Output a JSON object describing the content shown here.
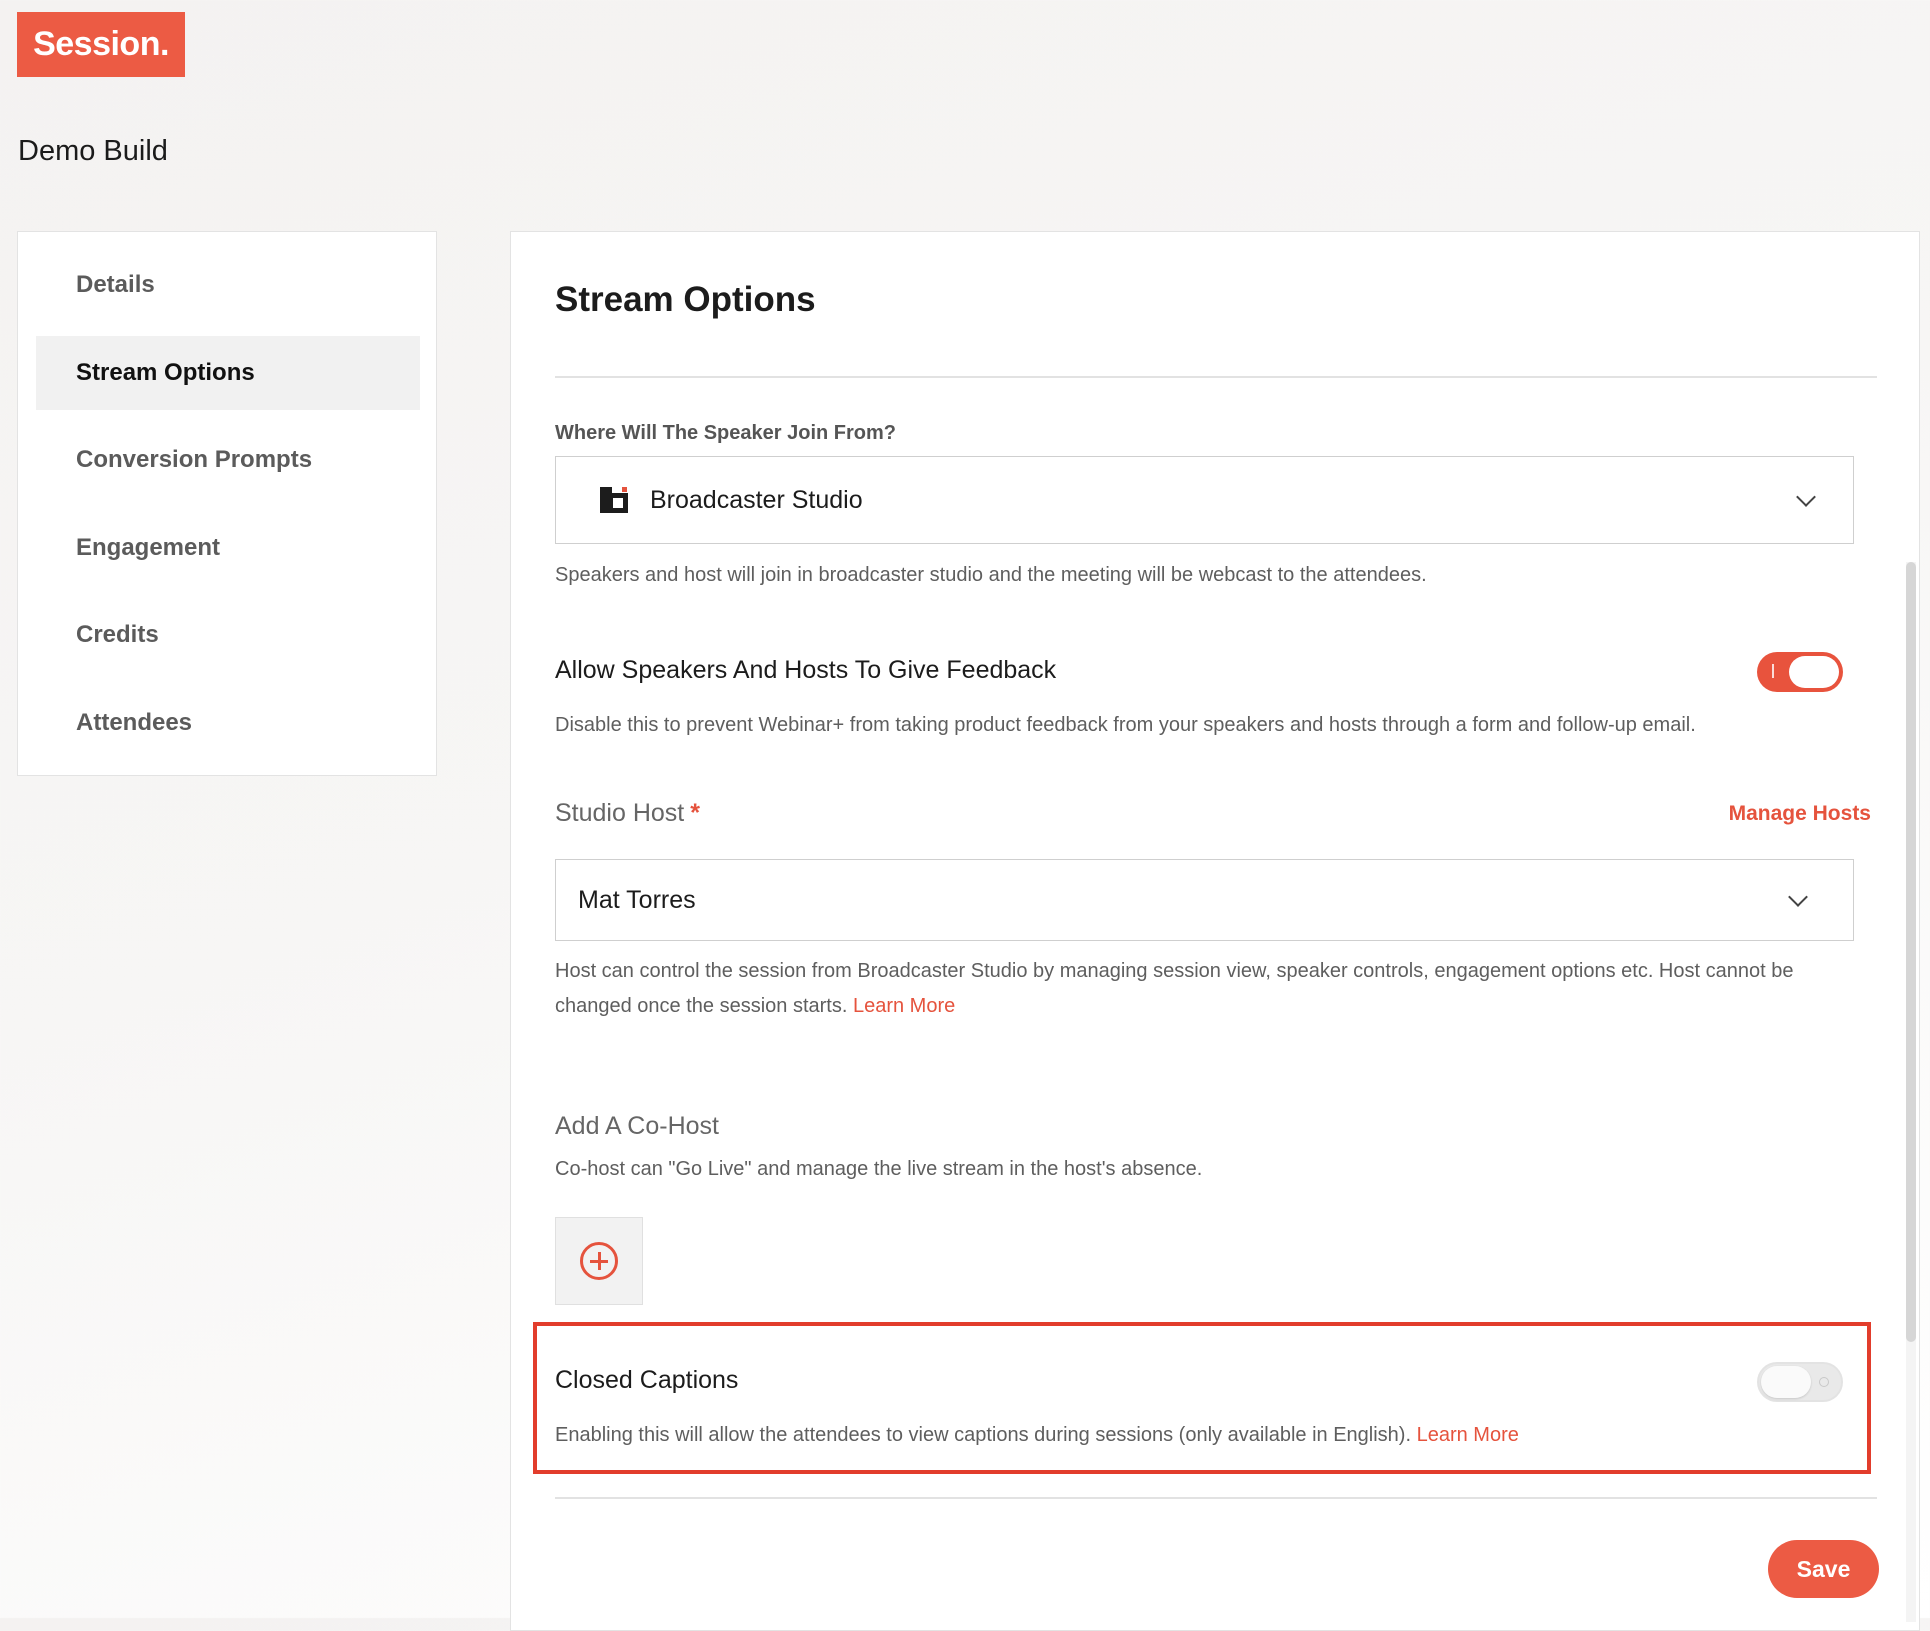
{
  "brand": {
    "logo_text": "Session.",
    "accent": "#ec5b44"
  },
  "build_name": "Demo Build",
  "sidebar": {
    "items": [
      {
        "label": "Details",
        "active": false
      },
      {
        "label": "Stream Options",
        "active": true
      },
      {
        "label": "Conversion Prompts",
        "active": false
      },
      {
        "label": "Engagement",
        "active": false
      },
      {
        "label": "Credits",
        "active": false
      },
      {
        "label": "Attendees",
        "active": false
      }
    ]
  },
  "main": {
    "title": "Stream Options",
    "speaker_join": {
      "label": "Where Will The Speaker Join From?",
      "selected": "Broadcaster Studio",
      "icon": "broadcaster-studio-icon",
      "description": "Speakers and host will join in broadcaster studio and the meeting will be webcast to the attendees."
    },
    "feedback": {
      "label": "Allow Speakers And Hosts To Give Feedback",
      "enabled": true,
      "description": "Disable this to prevent Webinar+ from taking product feedback from your speakers and hosts through a form and follow-up email."
    },
    "studio_host": {
      "label": "Studio Host",
      "required_mark": "*",
      "manage_link": "Manage Hosts",
      "selected": "Mat Torres",
      "description": "Host can control the session from Broadcaster Studio by managing session view, speaker controls, engagement options etc. Host cannot be changed once the session starts.",
      "learn_more": "Learn More"
    },
    "co_host": {
      "label": "Add A Co-Host",
      "description": "Co-host can \"Go Live\" and manage the live stream in the host's absence."
    },
    "closed_captions": {
      "label": "Closed Captions",
      "enabled": false,
      "description": "Enabling this will allow the attendees to view captions during sessions (only available in English).",
      "learn_more": "Learn More"
    },
    "save_label": "Save"
  }
}
